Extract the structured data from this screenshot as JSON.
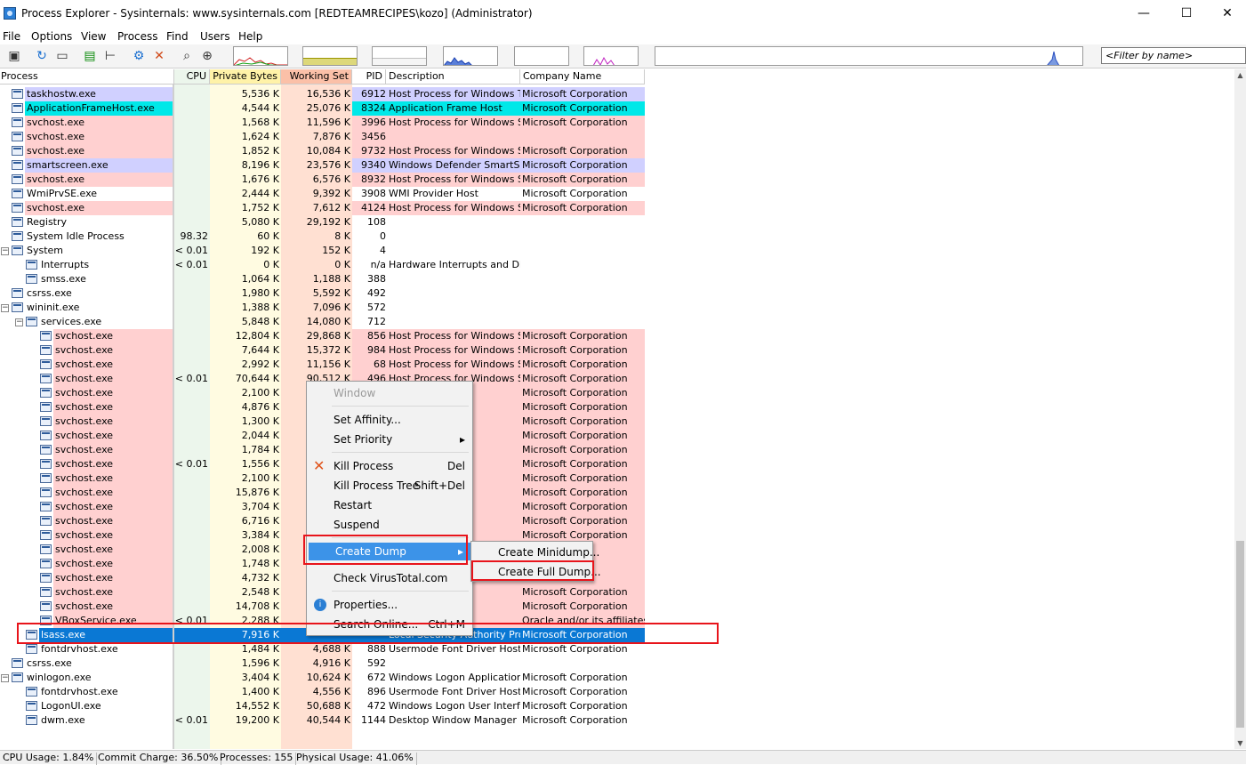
{
  "window": {
    "title": "Process Explorer - Sysinternals: www.sysinternals.com [REDTEAMRECIPES\\kozo] (Administrator)",
    "minimize": "—",
    "maximize": "☐",
    "close": "✕"
  },
  "menu": [
    "File",
    "Options",
    "View",
    "Process",
    "Find",
    "Users",
    "Help"
  ],
  "filter": {
    "placeholder": "<Filter by name>"
  },
  "columns": {
    "process": "Process",
    "cpu": "CPU",
    "private": "Private Bytes",
    "working": "Working Set",
    "pid": "PID",
    "description": "Description",
    "company": "Company Name"
  },
  "colors": {
    "service": "#ffd0d0",
    "own": "#d0d0ff",
    "immersive": "#00e8e8",
    "selected": "#0a78d4",
    "cpu_col": "#ecf6ec",
    "private_col": "#fffbe1",
    "working_col": "#ffe0d2"
  },
  "rows": [
    {
      "name": "taskhostw.exe",
      "cpu": "",
      "priv": "5,536 K",
      "ws": "16,536 K",
      "pid": "6912",
      "desc": "Host Process for Windows T...",
      "co": "Microsoft Corporation",
      "type": "own",
      "indent": 0
    },
    {
      "name": "ApplicationFrameHost.exe",
      "cpu": "",
      "priv": "4,544 K",
      "ws": "25,076 K",
      "pid": "8324",
      "desc": "Application Frame Host",
      "co": "Microsoft Corporation",
      "type": "immersive",
      "indent": 0
    },
    {
      "name": "svchost.exe",
      "cpu": "",
      "priv": "1,568 K",
      "ws": "11,596 K",
      "pid": "3996",
      "desc": "Host Process for Windows S...",
      "co": "Microsoft Corporation",
      "type": "service",
      "indent": 0
    },
    {
      "name": "svchost.exe",
      "cpu": "",
      "priv": "1,624 K",
      "ws": "7,876 K",
      "pid": "3456",
      "desc": "",
      "co": "",
      "type": "service",
      "indent": 0
    },
    {
      "name": "svchost.exe",
      "cpu": "",
      "priv": "1,852 K",
      "ws": "10,084 K",
      "pid": "9732",
      "desc": "Host Process for Windows S...",
      "co": "Microsoft Corporation",
      "type": "service",
      "indent": 0
    },
    {
      "name": "smartscreen.exe",
      "cpu": "",
      "priv": "8,196 K",
      "ws": "23,576 K",
      "pid": "9340",
      "desc": "Windows Defender SmartScr...",
      "co": "Microsoft Corporation",
      "type": "own",
      "indent": 0
    },
    {
      "name": "svchost.exe",
      "cpu": "",
      "priv": "1,676 K",
      "ws": "6,576 K",
      "pid": "8932",
      "desc": "Host Process for Windows S...",
      "co": "Microsoft Corporation",
      "type": "service",
      "indent": 0
    },
    {
      "name": "WmiPrvSE.exe",
      "cpu": "",
      "priv": "2,444 K",
      "ws": "9,392 K",
      "pid": "3908",
      "desc": "WMI Provider Host",
      "co": "Microsoft Corporation",
      "type": "none",
      "indent": 0
    },
    {
      "name": "svchost.exe",
      "cpu": "",
      "priv": "1,752 K",
      "ws": "7,612 K",
      "pid": "4124",
      "desc": "Host Process for Windows S...",
      "co": "Microsoft Corporation",
      "type": "service",
      "indent": 0
    },
    {
      "name": "Registry",
      "cpu": "",
      "priv": "5,080 K",
      "ws": "29,192 K",
      "pid": "108",
      "desc": "",
      "co": "",
      "type": "none",
      "indent": 0
    },
    {
      "name": "System Idle Process",
      "cpu": "98.32",
      "priv": "60 K",
      "ws": "8 K",
      "pid": "0",
      "desc": "",
      "co": "",
      "type": "none",
      "indent": 0
    },
    {
      "name": "System",
      "cpu": "< 0.01",
      "priv": "192 K",
      "ws": "152 K",
      "pid": "4",
      "desc": "",
      "co": "",
      "type": "none",
      "indent": 0,
      "exp": "−"
    },
    {
      "name": "Interrupts",
      "cpu": "< 0.01",
      "priv": "0 K",
      "ws": "0 K",
      "pid": "n/a",
      "desc": "Hardware Interrupts and DPCs",
      "co": "",
      "type": "none",
      "indent": 1
    },
    {
      "name": "smss.exe",
      "cpu": "",
      "priv": "1,064 K",
      "ws": "1,188 K",
      "pid": "388",
      "desc": "",
      "co": "",
      "type": "none",
      "indent": 1
    },
    {
      "name": "csrss.exe",
      "cpu": "",
      "priv": "1,980 K",
      "ws": "5,592 K",
      "pid": "492",
      "desc": "",
      "co": "",
      "type": "none",
      "indent": 0
    },
    {
      "name": "wininit.exe",
      "cpu": "",
      "priv": "1,388 K",
      "ws": "7,096 K",
      "pid": "572",
      "desc": "",
      "co": "",
      "type": "none",
      "indent": 0,
      "exp": "−"
    },
    {
      "name": "services.exe",
      "cpu": "",
      "priv": "5,848 K",
      "ws": "14,080 K",
      "pid": "712",
      "desc": "",
      "co": "",
      "type": "none",
      "indent": 1,
      "exp": "−"
    },
    {
      "name": "svchost.exe",
      "cpu": "",
      "priv": "12,804 K",
      "ws": "29,868 K",
      "pid": "856",
      "desc": "Host Process for Windows S...",
      "co": "Microsoft Corporation",
      "type": "service",
      "indent": 2
    },
    {
      "name": "svchost.exe",
      "cpu": "",
      "priv": "7,644 K",
      "ws": "15,372 K",
      "pid": "984",
      "desc": "Host Process for Windows S...",
      "co": "Microsoft Corporation",
      "type": "service",
      "indent": 2
    },
    {
      "name": "svchost.exe",
      "cpu": "",
      "priv": "2,992 K",
      "ws": "11,156 K",
      "pid": "68",
      "desc": "Host Process for Windows S...",
      "co": "Microsoft Corporation",
      "type": "service",
      "indent": 2
    },
    {
      "name": "svchost.exe",
      "cpu": "< 0.01",
      "priv": "70,644 K",
      "ws": "90,512 K",
      "pid": "496",
      "desc": "Host Process for Windows S...",
      "co": "Microsoft Corporation",
      "type": "service",
      "indent": 2
    },
    {
      "name": "svchost.exe",
      "cpu": "",
      "priv": "2,100 K",
      "ws": "",
      "pid": "",
      "desc": "ndows S...",
      "co": "Microsoft Corporation",
      "type": "service",
      "indent": 2
    },
    {
      "name": "svchost.exe",
      "cpu": "",
      "priv": "4,876 K",
      "ws": "",
      "pid": "",
      "desc": "ndows S...",
      "co": "Microsoft Corporation",
      "type": "service",
      "indent": 2
    },
    {
      "name": "svchost.exe",
      "cpu": "",
      "priv": "1,300 K",
      "ws": "",
      "pid": "",
      "desc": "ndows S...",
      "co": "Microsoft Corporation",
      "type": "service",
      "indent": 2
    },
    {
      "name": "svchost.exe",
      "cpu": "",
      "priv": "2,044 K",
      "ws": "",
      "pid": "",
      "desc": "ndows S...",
      "co": "Microsoft Corporation",
      "type": "service",
      "indent": 2
    },
    {
      "name": "svchost.exe",
      "cpu": "",
      "priv": "1,784 K",
      "ws": "",
      "pid": "",
      "desc": "ndows S...",
      "co": "Microsoft Corporation",
      "type": "service",
      "indent": 2
    },
    {
      "name": "svchost.exe",
      "cpu": "< 0.01",
      "priv": "1,556 K",
      "ws": "",
      "pid": "",
      "desc": "ndows S...",
      "co": "Microsoft Corporation",
      "type": "service",
      "indent": 2
    },
    {
      "name": "svchost.exe",
      "cpu": "",
      "priv": "2,100 K",
      "ws": "",
      "pid": "",
      "desc": "ndows S...",
      "co": "Microsoft Corporation",
      "type": "service",
      "indent": 2
    },
    {
      "name": "svchost.exe",
      "cpu": "",
      "priv": "15,876 K",
      "ws": "",
      "pid": "",
      "desc": "ndows S...",
      "co": "Microsoft Corporation",
      "type": "service",
      "indent": 2
    },
    {
      "name": "svchost.exe",
      "cpu": "",
      "priv": "3,704 K",
      "ws": "",
      "pid": "",
      "desc": "ndows S...",
      "co": "Microsoft Corporation",
      "type": "service",
      "indent": 2
    },
    {
      "name": "svchost.exe",
      "cpu": "",
      "priv": "6,716 K",
      "ws": "",
      "pid": "",
      "desc": "ndows S...",
      "co": "Microsoft Corporation",
      "type": "service",
      "indent": 2
    },
    {
      "name": "svchost.exe",
      "cpu": "",
      "priv": "3,384 K",
      "ws": "",
      "pid": "",
      "desc": "ndows S...",
      "co": "Microsoft Corporation",
      "type": "service",
      "indent": 2
    },
    {
      "name": "svchost.exe",
      "cpu": "",
      "priv": "2,008 K",
      "ws": "",
      "pid": "",
      "desc": "",
      "co": "tion",
      "type": "service",
      "indent": 2
    },
    {
      "name": "svchost.exe",
      "cpu": "",
      "priv": "1,748 K",
      "ws": "",
      "pid": "",
      "desc": "",
      "co": "tion",
      "type": "service",
      "indent": 2
    },
    {
      "name": "svchost.exe",
      "cpu": "",
      "priv": "4,732 K",
      "ws": "",
      "pid": "",
      "desc": "",
      "co": "tion",
      "type": "service",
      "indent": 2
    },
    {
      "name": "svchost.exe",
      "cpu": "",
      "priv": "2,548 K",
      "ws": "",
      "pid": "",
      "desc": "ndows S...",
      "co": "Microsoft Corporation",
      "type": "service",
      "indent": 2
    },
    {
      "name": "svchost.exe",
      "cpu": "",
      "priv": "14,708 K",
      "ws": "",
      "pid": "",
      "desc": "ndows S...",
      "co": "Microsoft Corporation",
      "type": "service",
      "indent": 2
    },
    {
      "name": "VBoxService.exe",
      "cpu": "< 0.01",
      "priv": "2,288 K",
      "ws": "",
      "pid": "",
      "desc": "ditions S...",
      "co": "Oracle and/or its affiliates",
      "type": "service",
      "indent": 2
    },
    {
      "name": "lsass.exe",
      "cpu": "",
      "priv": "7,916 K",
      "ws": "",
      "pid": "",
      "desc": "Local Security Authority Proc...",
      "co": "Microsoft Corporation",
      "type": "selected",
      "indent": 1
    },
    {
      "name": "fontdrvhost.exe",
      "cpu": "",
      "priv": "1,484 K",
      "ws": "4,688 K",
      "pid": "888",
      "desc": "Usermode Font Driver Host",
      "co": "Microsoft Corporation",
      "type": "none",
      "indent": 1
    },
    {
      "name": "csrss.exe",
      "cpu": "",
      "priv": "1,596 K",
      "ws": "4,916 K",
      "pid": "592",
      "desc": "",
      "co": "",
      "type": "none",
      "indent": 0
    },
    {
      "name": "winlogon.exe",
      "cpu": "",
      "priv": "3,404 K",
      "ws": "10,624 K",
      "pid": "672",
      "desc": "Windows Logon Application",
      "co": "Microsoft Corporation",
      "type": "none",
      "indent": 0,
      "exp": "−"
    },
    {
      "name": "fontdrvhost.exe",
      "cpu": "",
      "priv": "1,400 K",
      "ws": "4,556 K",
      "pid": "896",
      "desc": "Usermode Font Driver Host",
      "co": "Microsoft Corporation",
      "type": "none",
      "indent": 1
    },
    {
      "name": "LogonUI.exe",
      "cpu": "",
      "priv": "14,552 K",
      "ws": "50,688 K",
      "pid": "472",
      "desc": "Windows Logon User Interfa...",
      "co": "Microsoft Corporation",
      "type": "none",
      "indent": 1
    },
    {
      "name": "dwm.exe",
      "cpu": "< 0.01",
      "priv": "19,200 K",
      "ws": "40,544 K",
      "pid": "1144",
      "desc": "Desktop Window Manager",
      "co": "Microsoft Corporation",
      "type": "none",
      "indent": 1
    }
  ],
  "context_menu": {
    "window": "Window",
    "set_affinity": "Set Affinity...",
    "set_priority": "Set Priority",
    "kill": "Kill Process",
    "kill_shortcut": "Del",
    "kill_tree": "Kill Process Tree",
    "kill_tree_shortcut": "Shift+Del",
    "restart": "Restart",
    "suspend": "Suspend",
    "create_dump": "Create Dump",
    "virustotal": "Check VirusTotal.com",
    "properties": "Properties...",
    "search_online": "Search Online...",
    "search_shortcut": "Ctrl+M"
  },
  "submenu": {
    "mini": "Create Minidump...",
    "full": "Create Full Dump..."
  },
  "status": {
    "cpu": "CPU Usage: 1.84%",
    "commit": "Commit Charge: 36.50%",
    "processes": "Processes: 155",
    "physical": "Physical Usage: 41.06%"
  }
}
